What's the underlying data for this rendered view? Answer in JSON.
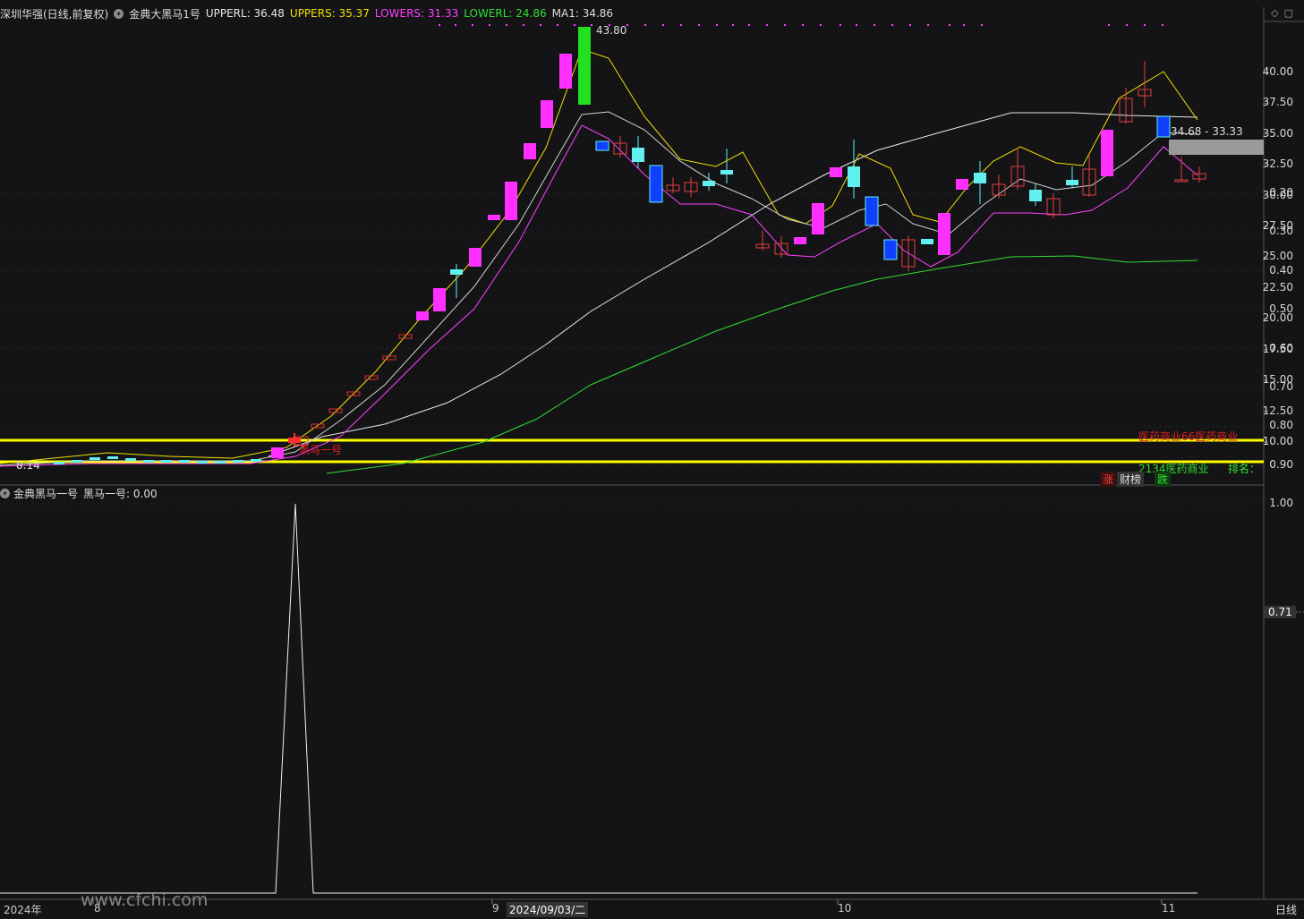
{
  "header": {
    "stock": "深圳华强(日线,前复权)",
    "indicator": "金典大黑马1号",
    "upperl_label": "UPPERL: 36.48",
    "uppers_label": "UPPERS: 35.37",
    "lowers_label": "LOWERS: 31.33",
    "lowerl_label": "LOWERL: 24.86",
    "ma1_label": "MA1: 34.86"
  },
  "colors": {
    "upperl": "#e8e8e8",
    "uppers": "#f0e000",
    "lowers": "#ff40ff",
    "lowerl": "#30e030",
    "ma1": "#e8e8e8",
    "up_candle": "#ff30ff",
    "down_candle": "#60f0f0",
    "hline": "#ffff00"
  },
  "main_chart": {
    "y_ticks": [
      "40.00",
      "37.50",
      "35.00",
      "32.50",
      "30.00",
      "27.50",
      "25.00",
      "22.50",
      "20.00",
      "17.50",
      "15.00",
      "12.50",
      "10.00"
    ],
    "max_label": "43.80",
    "min_label": "8.14",
    "range_label": "34.68 - 33.33",
    "signal_label": "黑马一号",
    "sector_label": "医药商业66医药商业",
    "sector_rank": "2134医药商业",
    "rank_label": "排名："
  },
  "bottom_buttons": {
    "zhang": "涨",
    "caibang": "财榜",
    "die": "跌"
  },
  "sub_chart": {
    "indicator": "金典黑马一号",
    "value_label": "黑马一号: 0.00",
    "y_ticks": [
      "1.00",
      "0.90",
      "0.80",
      "0.70",
      "0.60",
      "0.50",
      "0.40",
      "0.30",
      "0.20"
    ],
    "cursor_value": "0.71"
  },
  "x_axis": {
    "labels": [
      "2024年",
      "8",
      "9",
      "2024/09/03/二",
      "10",
      "11"
    ],
    "period": "日线"
  },
  "watermark": "www.cfchi.com",
  "chart_data": {
    "type": "candlestick",
    "series": [
      {
        "name": "UPPERL",
        "values": [
          36.48
        ]
      },
      {
        "name": "UPPERS",
        "values": [
          35.37
        ]
      },
      {
        "name": "LOWERS",
        "values": [
          31.33
        ]
      },
      {
        "name": "LOWERL",
        "values": [
          24.86
        ]
      },
      {
        "name": "MA1",
        "values": [
          34.86
        ]
      }
    ],
    "ylim": [
      7.5,
      44.5
    ],
    "sub_series": {
      "name": "黑马一号",
      "ylim": [
        0,
        1
      ]
    }
  }
}
